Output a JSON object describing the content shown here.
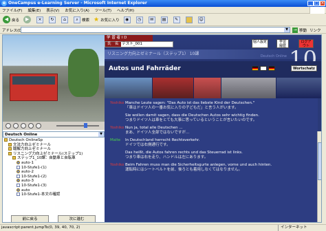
{
  "window": {
    "title": "OneCampus e-Learning Server - Microsoft Internet Explorer"
  },
  "menu": [
    "ファイル(F)",
    "編集(E)",
    "表示(V)",
    "お気に入り(A)",
    "ツール(T)",
    "ヘルプ(H)"
  ],
  "toolbar": {
    "back": "戻る",
    "search": "検索",
    "favorites": "お気に入り"
  },
  "address": {
    "label": "アドレス(D)",
    "go": "移動",
    "links": "リンク"
  },
  "left": {
    "selector": "Deutsch Online",
    "tree": [
      {
        "label": "Deutsch OnlineSp",
        "level": 0,
        "icon": "folder"
      },
      {
        "label": "文法力向上ゼミナール",
        "level": 1,
        "icon": "folder"
      },
      {
        "label": "聴解力向上ゼミナール",
        "level": 1,
        "icon": "folder"
      },
      {
        "label": "リスニング力向上ゼミナール(ステップ1)",
        "level": 1,
        "icon": "folder"
      },
      {
        "label": "ステップ1_10課：自動車と自転車",
        "level": 2,
        "icon": "folder"
      },
      {
        "label": "auto-1",
        "level": 3,
        "icon": "speaker"
      },
      {
        "label": "10-Stufe1-(1)",
        "level": 3,
        "icon": "doc"
      },
      {
        "label": "auto-2",
        "level": 3,
        "icon": "speaker"
      },
      {
        "label": "10-Stufe1-(2)",
        "level": 3,
        "icon": "doc"
      },
      {
        "label": "auto-3",
        "level": 3,
        "icon": "speaker"
      },
      {
        "label": "10-Stufe1-(3)",
        "level": 3,
        "icon": "doc"
      },
      {
        "label": "auto",
        "level": 3,
        "icon": "speaker"
      },
      {
        "label": "10-Stufe1-本文の確認",
        "level": 3,
        "icon": "doc"
      }
    ],
    "prev": "前に戻る",
    "next": "次に進む"
  },
  "header": {
    "id_label": "学 習 者 I D",
    "name_label": "氏　名",
    "name_value": "テスト_001",
    "btn1": "個人設定",
    "btn2": "学習履歴",
    "btn3": "ログアウト",
    "strip": "リスニング力向上ゼミナール（ステップ1） 10課",
    "brand": "Deutsch Online",
    "lesson_num": "10",
    "title": "Autos und Fahrräder",
    "wortschatz": "Wortschatz"
  },
  "dialog": [
    {
      "speaker": "Yoshiko",
      "m": false,
      "de": "Manche Leute sagen: \"Das Auto ist das liebste Kind der Deutschen.\"",
      "jp": "「車はドイツ人の一番お気に入りの子どもだ」と言う人がいます。"
    },
    {
      "speaker": "",
      "m": false,
      "de": "Sie wollen damit sagen, dass die Deutschen Autos sehr wichtig finden.",
      "jp": "つまりドイツ人は車をとても大事に思っているということが言いたいのです。"
    },
    {
      "speaker": "Yoshiko",
      "m": false,
      "de": "Nun ja, total alle Deutschen ...",
      "jp": "まあ、ドイツ人全部ではないですが…"
    },
    {
      "speaker": "Malte",
      "m": true,
      "de": "In Deutschland herrscht Rechtsverkehr.",
      "jp": "ドイツでは右側通行です。"
    },
    {
      "speaker": "",
      "m": false,
      "de": "Das heißt, die Autos fahren rechts und das Steuerrad ist links.",
      "jp": "つまり車は右を走り、ハンドルは左にあります。"
    },
    {
      "speaker": "Yoshiko",
      "m": false,
      "de": "Beim Fahren muss man die Sicherheitsgurte anlegen, vorne und auch hinten.",
      "jp": "運転時にはシートベルトを前、後ろとも着用しなくてはなりません。"
    }
  ],
  "status": {
    "left": "javascript:parent.jumpTo(0, 39, 40, 70, 2)",
    "zone": "インターネット"
  }
}
